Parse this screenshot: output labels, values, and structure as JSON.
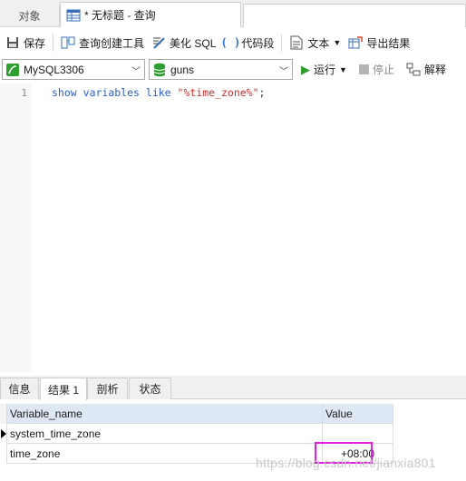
{
  "tabs": {
    "objects_label": "对象",
    "query_label": "* 无标题 - 查询"
  },
  "toolbar": {
    "save_label": "保存",
    "query_builder_label": "查询创建工具",
    "beautify_label": "美化 SQL",
    "snippet_label": "代码段",
    "text_label": "文本",
    "export_label": "导出结果"
  },
  "connection": {
    "server": "MySQL3306",
    "database": "guns"
  },
  "actions": {
    "run_label": "运行",
    "stop_label": "停止",
    "explain_label": "解释"
  },
  "editor": {
    "line_number": "1",
    "kw1": "show",
    "kw2": "variables",
    "kw3": "like",
    "string": "\"%time_zone%\"",
    "terminator": ";"
  },
  "result_tabs": [
    "信息",
    "结果 1",
    "剖析",
    "状态"
  ],
  "grid": {
    "columns": [
      "Variable_name",
      "Value"
    ],
    "rows": [
      {
        "name": "system_time_zone",
        "value": ""
      },
      {
        "name": "time_zone",
        "value": "+08:00"
      }
    ]
  },
  "watermark": "https://blog.csdn.net/jianxia801",
  "colors": {
    "keyword": "#2a5fd0",
    "string": "#c8322f",
    "run_icon": "#2e9e2e",
    "highlight_box": "#e020e0",
    "header_bg": "#dde8f4"
  }
}
